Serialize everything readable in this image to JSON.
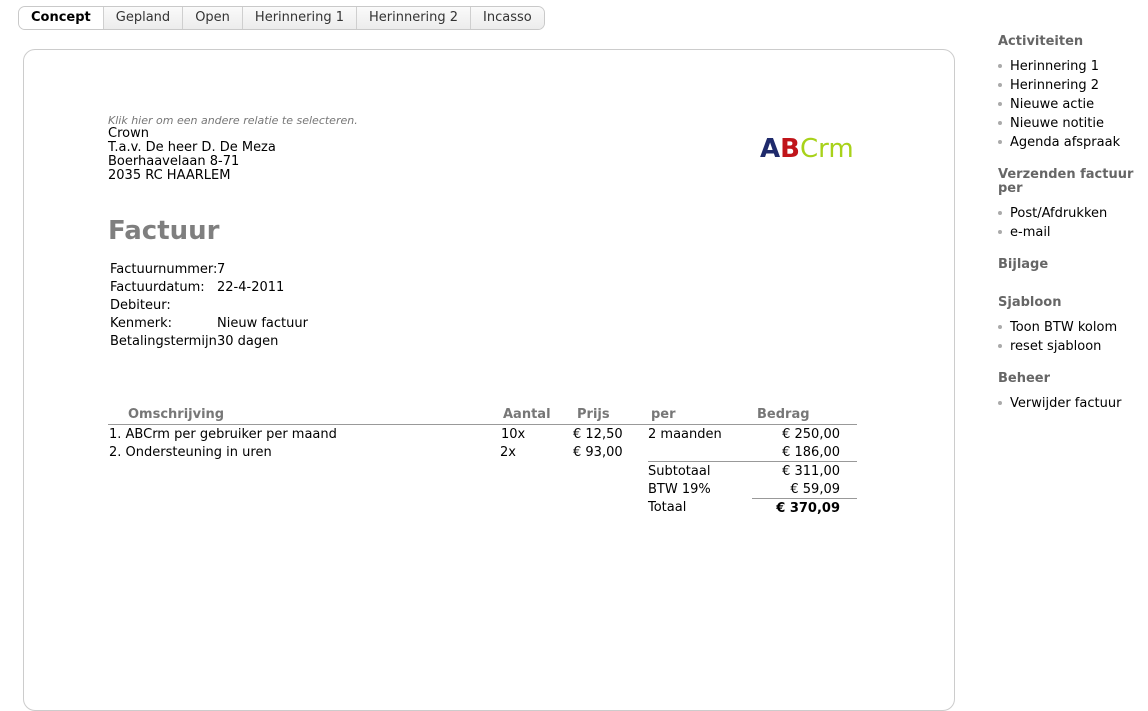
{
  "tabs": [
    {
      "label": "Concept",
      "active": true
    },
    {
      "label": "Gepland"
    },
    {
      "label": "Open"
    },
    {
      "label": "Herinnering 1"
    },
    {
      "label": "Herinnering 2"
    },
    {
      "label": "Incasso"
    }
  ],
  "invoice": {
    "select_relation_hint": "Klik hier om een andere relatie te selecteren.",
    "address": [
      "Crown",
      "T.a.v. De heer D. De Meza",
      "Boerhaavelaan 8-71",
      "2035 RC HAARLEM"
    ],
    "logo": {
      "a": "A",
      "b": "B",
      "crm": "Crm"
    },
    "title": "Factuur",
    "meta": {
      "number_label": "Factuurnummer:",
      "number": "7",
      "date_label": "Factuurdatum:",
      "date": "22-4-2011",
      "debtor_label": "Debiteur:",
      "debtor": "",
      "reference_label": "Kenmerk:",
      "reference": "Nieuw factuur",
      "terms_label": "Betalingstermijn",
      "terms": "30 dagen"
    },
    "columns": {
      "description": "Omschrijving",
      "quantity": "Aantal",
      "price": "Prijs",
      "per": "per",
      "amount": "Bedrag"
    },
    "lines": [
      {
        "description": "1. ABCrm per gebruiker per maand",
        "quantity": "10x",
        "price": "€ 12,50",
        "per": "2 maanden",
        "amount": "€ 250,00"
      },
      {
        "description": "2. Ondersteuning in uren",
        "quantity": "2x",
        "price": "€ 93,00",
        "per": "",
        "amount": "€ 186,00"
      }
    ],
    "totals": {
      "subtotal_label": "Subtotaal",
      "subtotal": "€ 311,00",
      "vat_label": "BTW 19%",
      "vat": "€ 59,09",
      "total_label": "Totaal",
      "total": "€ 370,09"
    }
  },
  "sidebar": {
    "activities_heading": "Activiteiten",
    "activities": [
      "Herinnering 1",
      "Herinnering 2",
      "Nieuwe actie",
      "Nieuwe notitie",
      "Agenda afspraak"
    ],
    "send_heading": "Verzenden factuur per",
    "send": [
      "Post/Afdrukken",
      "e-mail"
    ],
    "attachment_heading": "Bijlage",
    "template_heading": "Sjabloon",
    "template": [
      "Toon BTW kolom",
      "reset sjabloon"
    ],
    "manage_heading": "Beheer",
    "manage": [
      "Verwijder factuur"
    ]
  }
}
